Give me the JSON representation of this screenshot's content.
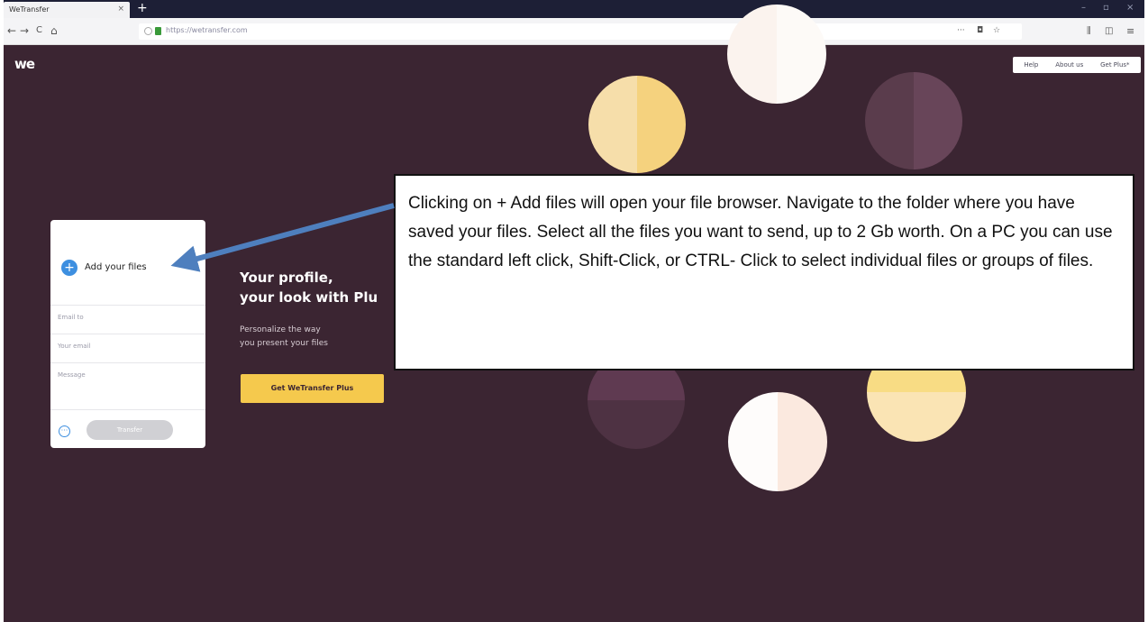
{
  "browser": {
    "tab_title": "WeTransfer",
    "tab_close": "×",
    "new_tab": "+",
    "url": "https://wetransfer.com",
    "nav_back": "←",
    "nav_forward": "→",
    "nav_reload": "C",
    "nav_home": "⌂",
    "url_actions": [
      "···",
      "◘",
      "☆"
    ],
    "toolbar_icons": [
      "⫼",
      "◫",
      "≡"
    ],
    "window_controls": [
      "–",
      "▫",
      "×"
    ]
  },
  "site": {
    "logo": "we",
    "nav": [
      "Help",
      "About us",
      "Get Plus*"
    ]
  },
  "transfer_card": {
    "add_icon": "+",
    "add_label": "Add your files",
    "email_to_placeholder": "Email to",
    "your_email_placeholder": "Your email",
    "message_placeholder": "Message",
    "options_icon": "···",
    "transfer_button": "Transfer"
  },
  "promo": {
    "title_line1": "Your profile,",
    "title_line2": "your look with Plu",
    "subtitle_line1": "Personalize the way",
    "subtitle_line2": "you present your files",
    "button": "Get WeTransfer Plus"
  },
  "annotation": {
    "text": "Clicking on + Add files will open your file browser. Navigate to the folder where you have saved your files. Select all the files you want to send, up to 2 Gb worth. On a PC you can use the standard left click, Shift-Click, or CTRL- Click to select individual files or groups of files."
  },
  "colors": {
    "background": "#3b2532",
    "accent_blue": "#3d8fe0",
    "accent_yellow": "#f5c94d"
  }
}
